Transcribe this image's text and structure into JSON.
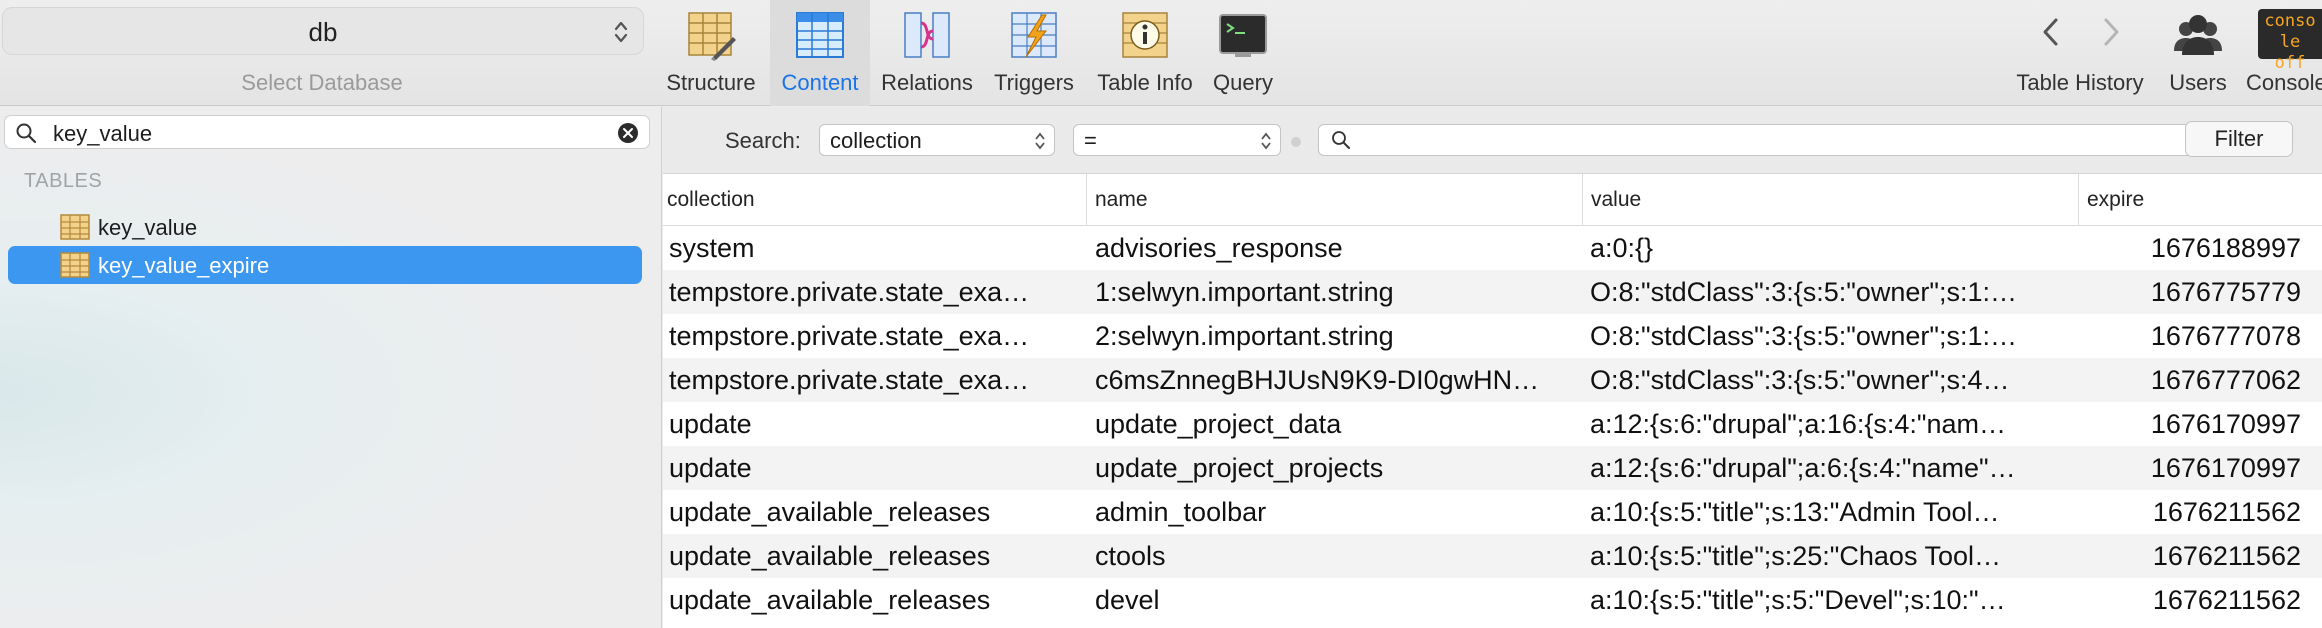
{
  "toolbar": {
    "database": {
      "name": "db",
      "caption": "Select Database"
    },
    "tools": [
      {
        "label": "Structure",
        "icon": "structure-icon"
      },
      {
        "label": "Content",
        "icon": "content-icon",
        "active": true
      },
      {
        "label": "Relations",
        "icon": "relations-icon"
      },
      {
        "label": "Triggers",
        "icon": "triggers-icon"
      },
      {
        "label": "Table Info",
        "icon": "table-info-icon"
      },
      {
        "label": "Query",
        "icon": "query-icon"
      }
    ],
    "history_label": "Table History",
    "users_label": "Users",
    "console_label": "Console",
    "console_icon_text": "conso le off"
  },
  "sidebar": {
    "search_value": "key_value",
    "section": "TABLES",
    "tables": [
      {
        "name": "key_value",
        "selected": false
      },
      {
        "name": "key_value_expire",
        "selected": true
      }
    ]
  },
  "filter": {
    "label": "Search:",
    "field": "collection",
    "operator": "=",
    "query": "",
    "button": "Filter"
  },
  "table": {
    "columns": [
      "collection",
      "name",
      "value",
      "expire"
    ],
    "rows": [
      [
        "system",
        "advisories_response",
        "a:0:{}",
        "1676188997"
      ],
      [
        "tempstore.private.state_exa…",
        "1:selwyn.important.string",
        "O:8:\"stdClass\":3:{s:5:\"owner\";s:1:…",
        "1676775779"
      ],
      [
        "tempstore.private.state_exa…",
        "2:selwyn.important.string",
        "O:8:\"stdClass\":3:{s:5:\"owner\";s:1:…",
        "1676777078"
      ],
      [
        "tempstore.private.state_exa…",
        "c6msZnnegBHJUsN9K9-DI0gwHN…",
        "O:8:\"stdClass\":3:{s:5:\"owner\";s:4…",
        "1676777062"
      ],
      [
        "update",
        "update_project_data",
        "a:12:{s:6:\"drupal\";a:16:{s:4:\"nam…",
        "1676170997"
      ],
      [
        "update",
        "update_project_projects",
        "a:12:{s:6:\"drupal\";a:6:{s:4:\"name\"…",
        "1676170997"
      ],
      [
        "update_available_releases",
        "admin_toolbar",
        "a:10:{s:5:\"title\";s:13:\"Admin Tool…",
        "1676211562"
      ],
      [
        "update_available_releases",
        "ctools",
        "a:10:{s:5:\"title\";s:25:\"Chaos Tool…",
        "1676211562"
      ],
      [
        "update_available_releases",
        "devel",
        "a:10:{s:5:\"title\";s:5:\"Devel\";s:10:\"…",
        "1676211562"
      ]
    ]
  },
  "colors": {
    "accent": "#3b97f0",
    "active_label": "#1a73e8"
  }
}
